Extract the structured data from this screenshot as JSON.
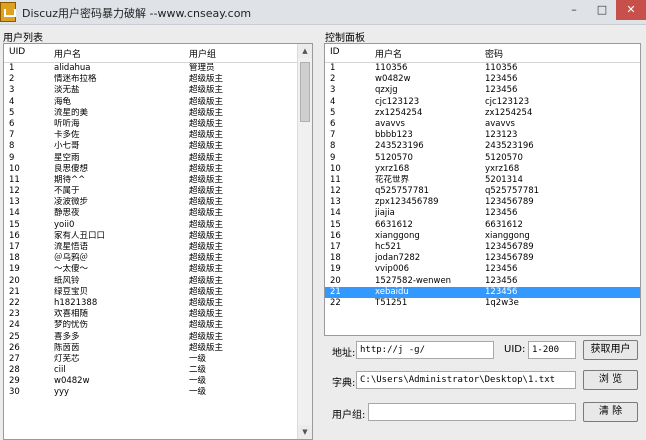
{
  "window": {
    "title": "Discuz用户密码暴力破解 --www.cnseay.com",
    "min": "–",
    "max": "□",
    "close": "✕"
  },
  "user_list": {
    "title": "用户列表",
    "columns": [
      "UID",
      "用户名",
      "用户组"
    ],
    "rows": [
      [
        "1",
        "alidahua",
        "管理员"
      ],
      [
        "2",
        "情迷布拉格",
        "超级版主"
      ],
      [
        "3",
        "淡无盐",
        "超级版主"
      ],
      [
        "4",
        "海龟",
        "超级版主"
      ],
      [
        "5",
        "流星的美",
        "超级版主"
      ],
      [
        "6",
        "听听海",
        "超级版主"
      ],
      [
        "7",
        "卡多佐",
        "超级版主"
      ],
      [
        "8",
        "小七哥",
        "超级版主"
      ],
      [
        "9",
        "星空雨",
        "超级版主"
      ],
      [
        "10",
        "良思傻想",
        "超级版主"
      ],
      [
        "11",
        "期待^^",
        "超级版主"
      ],
      [
        "12",
        "不属于",
        "超级版主"
      ],
      [
        "13",
        "凌波微步",
        "超级版主"
      ],
      [
        "14",
        "静思夜",
        "超级版主"
      ],
      [
        "15",
        "yoii0",
        "超级版主"
      ],
      [
        "16",
        "家有人丑口口",
        "超级版主"
      ],
      [
        "17",
        "流星悟语",
        "超级版主"
      ],
      [
        "18",
        "＠乌鸦＠",
        "超级版主"
      ],
      [
        "19",
        "～太傻～",
        "超级版主"
      ],
      [
        "20",
        "纸风铃",
        "超级版主"
      ],
      [
        "21",
        "绿豆宝贝",
        "超级版主"
      ],
      [
        "22",
        "h1821388",
        "超级版主"
      ],
      [
        "23",
        "欢喜相随",
        "超级版主"
      ],
      [
        "24",
        "梦的忧伤",
        "超级版主"
      ],
      [
        "25",
        "喜多多",
        "超级版主"
      ],
      [
        "26",
        "陈茵茵",
        "超级版主"
      ],
      [
        "27",
        "灯芜芯",
        "一级"
      ],
      [
        "28",
        "ciil",
        "二级"
      ],
      [
        "29",
        "w0482w",
        "一级"
      ],
      [
        "30",
        "yyy",
        "一级"
      ]
    ]
  },
  "control": {
    "title": "控制面板",
    "columns": [
      "ID",
      "用户名",
      "密码"
    ],
    "rows": [
      [
        "1",
        "110356",
        "110356"
      ],
      [
        "2",
        "w0482w",
        "123456"
      ],
      [
        "3",
        "qzxjg",
        "123456"
      ],
      [
        "4",
        "cjc123123",
        "cjc123123"
      ],
      [
        "5",
        "zx1254254",
        "zx1254254"
      ],
      [
        "6",
        "avavvs",
        "avavvs"
      ],
      [
        "7",
        "bbbb123",
        "123123"
      ],
      [
        "8",
        "243523196",
        "243523196"
      ],
      [
        "9",
        "5120570",
        "5120570"
      ],
      [
        "10",
        "yxrz168",
        "yxrz168"
      ],
      [
        "11",
        "花花世界",
        "5201314"
      ],
      [
        "12",
        "q525757781",
        "q525757781"
      ],
      [
        "13",
        "zpx123456789",
        "123456789"
      ],
      [
        "14",
        "jiajia",
        "123456"
      ],
      [
        "15",
        "6631612",
        "6631612"
      ],
      [
        "16",
        "xianggong",
        "xianggong"
      ],
      [
        "17",
        "hc521",
        "123456789"
      ],
      [
        "18",
        "jodan7282",
        "123456789"
      ],
      [
        "19",
        "vvip006",
        "123456"
      ],
      [
        "20",
        "1527582-wenwen",
        "123456"
      ],
      [
        "21",
        "xebaidu",
        "123456"
      ],
      [
        "22",
        "T51251",
        "1q2w3e"
      ]
    ],
    "selected_row": 20,
    "address_label": "地址:",
    "address_value": "http://j        -g/",
    "uid_label": "UID:",
    "uid_value": "1-200",
    "get_users_button": "获取用户",
    "dict_label": "字典:",
    "dict_value": "C:\\Users\\Administrator\\Desktop\\1.txt",
    "browse_button": "浏 览",
    "group_label": "用户组:",
    "group_value": "",
    "clear_button": "清 除"
  }
}
